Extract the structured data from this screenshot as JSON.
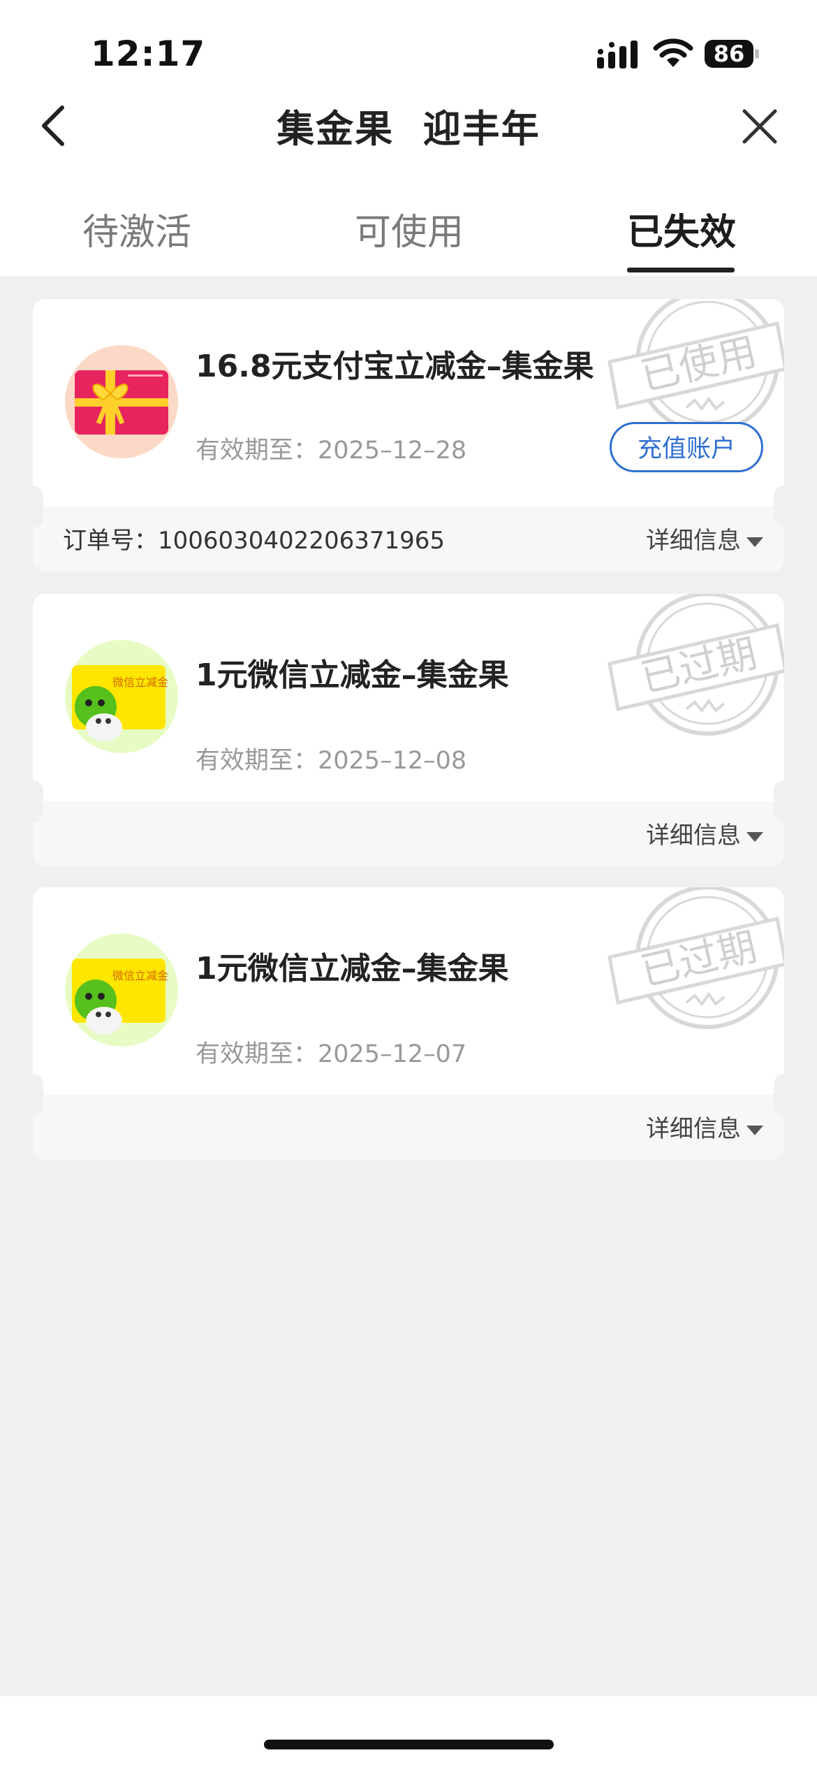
{
  "status_bar": {
    "time": "12:17",
    "battery": "86"
  },
  "header": {
    "title": "集金果  迎丰年"
  },
  "tabs": [
    {
      "label": "待激活",
      "active": false
    },
    {
      "label": "可使用",
      "active": false
    },
    {
      "label": "已失效",
      "active": true
    }
  ],
  "cards": [
    {
      "title": "16.8元支付宝立减金–集金果",
      "expiry": "有效期至：2025–12–28",
      "stamp": "已使用",
      "action_label": "充值账户",
      "order_no": "订单号：1006030402206371965",
      "detail_label": "详细信息"
    },
    {
      "title": "1元微信立减金–集金果",
      "expiry": "有效期至：2025–12–08",
      "stamp": "已过期",
      "thumb_text": "微信立减金",
      "detail_label": "详细信息"
    },
    {
      "title": "1元微信立减金–集金果",
      "expiry": "有效期至：2025–12–07",
      "stamp": "已过期",
      "thumb_text": "微信立减金",
      "detail_label": "详细信息"
    }
  ],
  "colors": {
    "accent": "#2f6fd0",
    "background": "#f0f0f0",
    "alipay_card": "#e8245f",
    "wechat_card": "#ffe600"
  }
}
